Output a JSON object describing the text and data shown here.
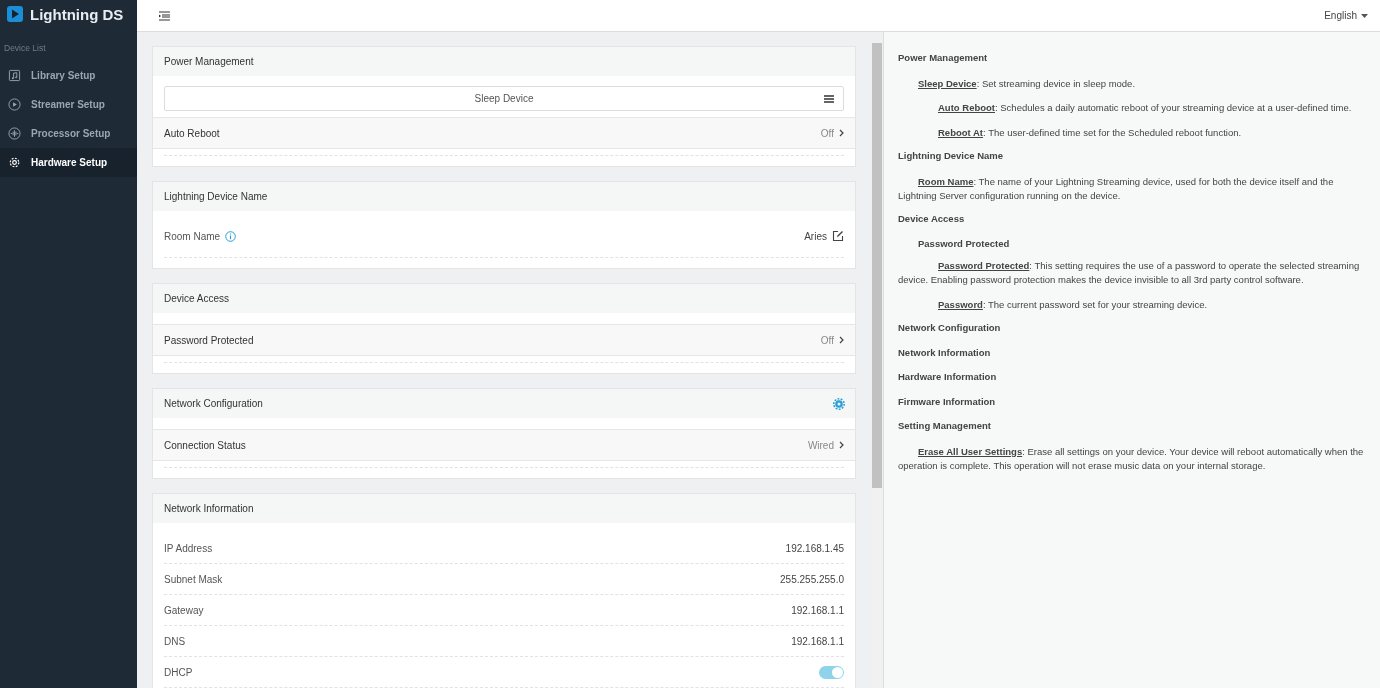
{
  "brand": "Lightning DS",
  "sidebar": {
    "section_label": "Device List",
    "items": [
      {
        "label": "Library Setup",
        "selected": false
      },
      {
        "label": "Streamer Setup",
        "selected": false
      },
      {
        "label": "Processor Setup",
        "selected": false
      },
      {
        "label": "Hardware Setup",
        "selected": true
      }
    ]
  },
  "language": "English",
  "cards": [
    {
      "title": "Power Management",
      "has_settings": false,
      "rows": [
        {
          "kind": "button",
          "label": "Sleep Device"
        },
        {
          "kind": "nav",
          "label": "Auto Reboot",
          "value": "Off"
        }
      ]
    },
    {
      "title": "Lightning Device Name",
      "has_settings": false,
      "rows": [
        {
          "kind": "edit",
          "label": "Room Name",
          "value": "Aries"
        }
      ]
    },
    {
      "title": "Device Access",
      "has_settings": false,
      "rows": [
        {
          "kind": "nav",
          "label": "Password Protected",
          "value": "Off"
        }
      ]
    },
    {
      "title": "Network Configuration",
      "has_settings": true,
      "rows": [
        {
          "kind": "nav",
          "label": "Connection Status",
          "value": "Wired"
        }
      ]
    },
    {
      "title": "Network Information",
      "has_settings": false,
      "rows": [
        {
          "kind": "info",
          "label": "IP Address",
          "value": "192.168.1.45"
        },
        {
          "kind": "info",
          "label": "Subnet Mask",
          "value": "255.255.255.0"
        },
        {
          "kind": "info",
          "label": "Gateway",
          "value": "192.168.1.1"
        },
        {
          "kind": "info",
          "label": "DNS",
          "value": "192.168.1.1"
        },
        {
          "kind": "toggle",
          "label": "DHCP",
          "on": true
        }
      ]
    }
  ],
  "help": [
    {
      "heading": "Power Management",
      "children": [
        {
          "term": "Sleep Device",
          "description": ": Set streaming device in sleep mode.",
          "children": [
            {
              "term": "Auto Reboot",
              "description": ": Schedules a daily automatic reboot of your streaming device at a user-defined time."
            },
            {
              "term": "Reboot At",
              "description": ": The user-defined time set for the Scheduled reboot function."
            }
          ]
        }
      ]
    },
    {
      "heading": "Lightning Device Name",
      "children": [
        {
          "term": "Room Name",
          "description": ": The name of your Lightning Streaming device, used for both the device itself and the Lightning Server configuration running on the device."
        }
      ]
    },
    {
      "heading": "Device Access",
      "children": [
        {
          "term": "Password Protected",
          "children": [
            {
              "term": "Password Protected",
              "description": ": This setting requires the use of a password to operate the selected streaming device. Enabling password protection makes the device invisible to all 3rd party control software."
            },
            {
              "term": "Password",
              "description": ": The current password set for your streaming device."
            }
          ]
        }
      ]
    },
    {
      "heading": "Network Configuration"
    },
    {
      "heading": "Network Information"
    },
    {
      "heading": "Hardware Information"
    },
    {
      "heading": "Firmware Information"
    },
    {
      "heading": "Setting Management",
      "children": [
        {
          "term": "Erase All User Settings",
          "description": ": Erase all settings on your device. Your device will reboot automatically when the operation is complete. This operation will not erase music data on your internal storage."
        }
      ]
    }
  ]
}
